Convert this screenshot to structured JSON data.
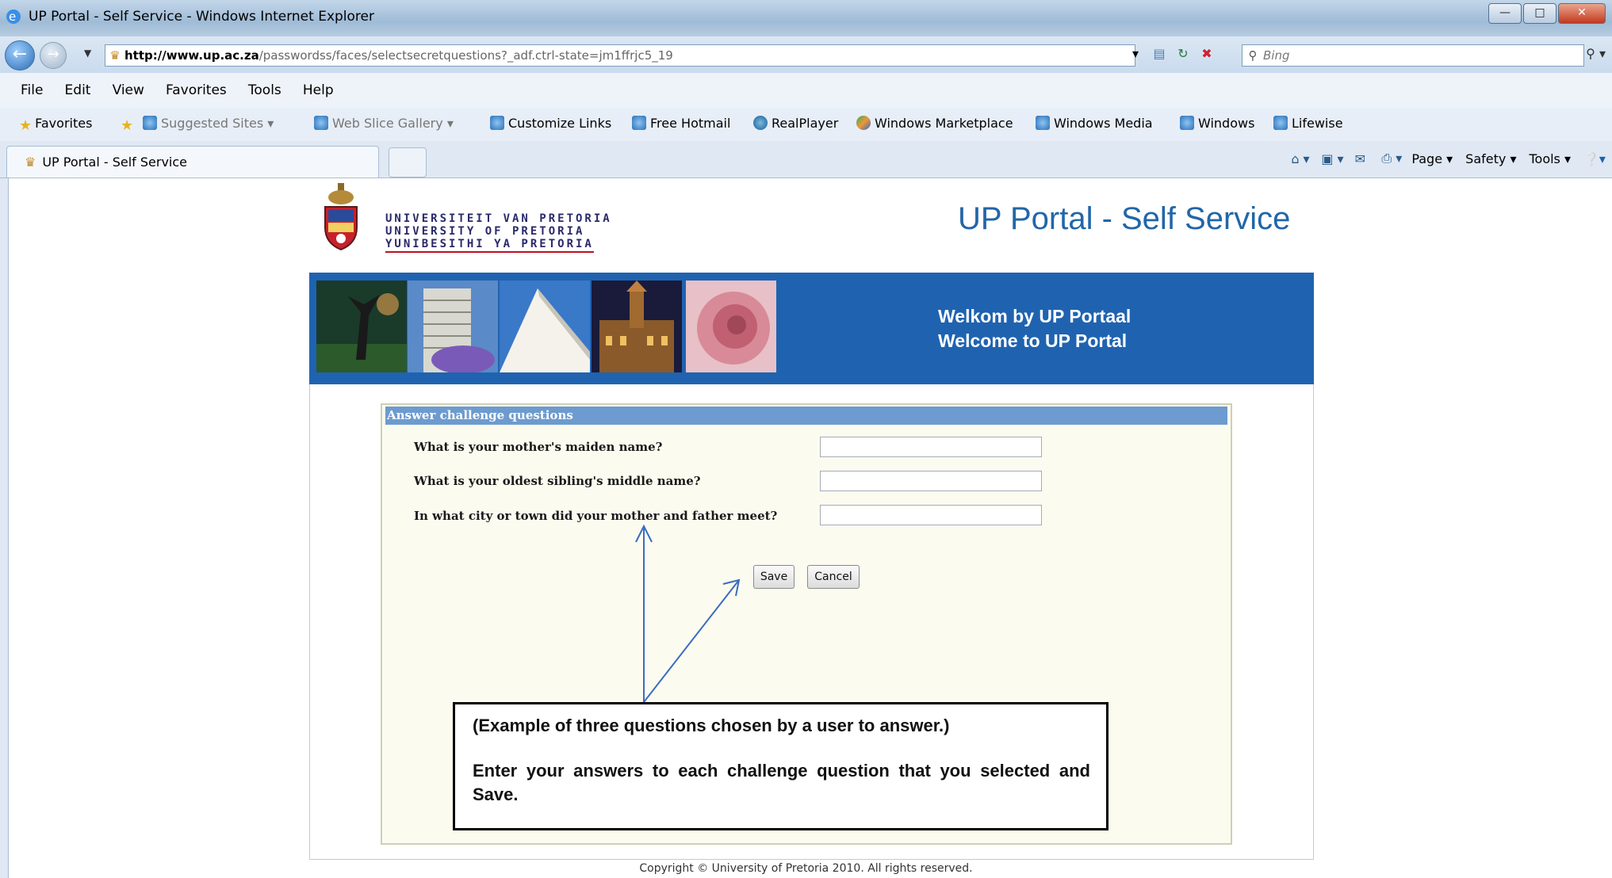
{
  "window": {
    "title": "UP Portal - Self Service - Windows Internet Explorer",
    "controls": [
      "minimize-icon",
      "maximize-icon",
      "close-icon"
    ]
  },
  "address": {
    "url_domain": "http://www.up.ac.za",
    "url_path": "/passwordss/faces/selectsecretquestions?_adf.ctrl-state=jm1ffrjc5_19",
    "search_placeholder": "Bing"
  },
  "menu": [
    "File",
    "Edit",
    "View",
    "Favorites",
    "Tools",
    "Help"
  ],
  "favorites_bar": {
    "favorites_label": "Favorites",
    "items": [
      "Suggested Sites ▾",
      "Web Slice Gallery ▾",
      "Customize Links",
      "Free Hotmail",
      "RealPlayer",
      "Windows Marketplace",
      "Windows Media",
      "Windows",
      "Lifewise"
    ]
  },
  "tab": {
    "title": "UP Portal - Self Service"
  },
  "command_bar": {
    "page": "Page ▾",
    "safety": "Safety ▾",
    "tools": "Tools ▾"
  },
  "page": {
    "logo_lines": [
      "UNIVERSITEIT VAN PRETORIA",
      "UNIVERSITY OF PRETORIA",
      "YUNIBESITHI YA PRETORIA"
    ],
    "title": "UP Portal - Self Service",
    "welcome_af": "Welkom by UP Portaal",
    "welcome_en": "Welcome to UP Portal",
    "panel_title": "Answer challenge questions",
    "questions": [
      {
        "label": "What is your mother's maiden name?",
        "value": ""
      },
      {
        "label": "What is your oldest sibling's middle name?",
        "value": ""
      },
      {
        "label": "In what city or town did your mother and father meet?",
        "value": ""
      }
    ],
    "save_label": "Save",
    "cancel_label": "Cancel",
    "callout_line1": "(Example of three questions chosen by a user to answer.)",
    "callout_line2": "Enter your answers to each challenge question that you selected and Save.",
    "copyright": "Copyright © University of Pretoria 2010. All rights reserved."
  },
  "colors": {
    "banner": "#1f63b0",
    "title": "#2266a8",
    "panel_header": "#6d9bcf"
  }
}
